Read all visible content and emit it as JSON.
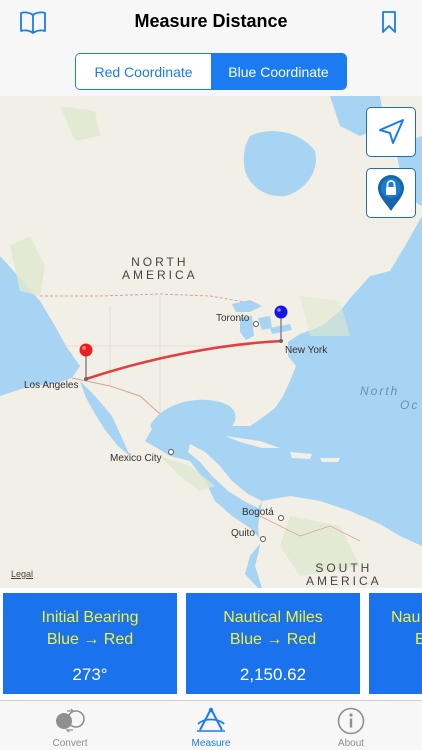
{
  "header": {
    "title": "Measure Distance",
    "left_icon": "book-icon",
    "right_icon": "bookmark-icon"
  },
  "segmented": {
    "options": [
      "Red Coordinate",
      "Blue Coordinate"
    ],
    "selected": "Blue Coordinate"
  },
  "map": {
    "labels": {
      "continent_na": "NORTH AMERICA",
      "continent_na_line1": "NORTH",
      "continent_na_line2": "AMERICA",
      "continent_sa_line1": "SOUTH",
      "continent_sa_line2": "AMERICA",
      "ocean_line1": "North",
      "ocean_line2": "Oc",
      "toronto": "Toronto",
      "new_york": "New York",
      "los_angeles": "Los Angeles",
      "mexico_city": "Mexico City",
      "bogota": "Bogotá",
      "quito": "Quito"
    },
    "legal": "Legal",
    "pins": {
      "red": "Los Angeles",
      "blue": "New York"
    },
    "colors": {
      "red_pin": "#e8201f",
      "blue_pin": "#1515e8",
      "line": "#e04040",
      "water": "#a8d4f3",
      "land": "#f2efe6"
    }
  },
  "cards": [
    {
      "line1": "Initial Bearing",
      "line2": "Blue → Red",
      "value": "273°"
    },
    {
      "line1": "Nautical Miles",
      "line2": "Blue → Red",
      "value": "2,150.62"
    },
    {
      "line1": "Nau",
      "line2": "B",
      "value": ""
    }
  ],
  "tabs": [
    {
      "label": "Convert",
      "icon": "convert-icon",
      "active": false
    },
    {
      "label": "Measure",
      "icon": "measure-icon",
      "active": true
    },
    {
      "label": "About",
      "icon": "info-icon",
      "active": false
    }
  ],
  "accent": "#1a7cf0",
  "card_color": "#1a72ec"
}
